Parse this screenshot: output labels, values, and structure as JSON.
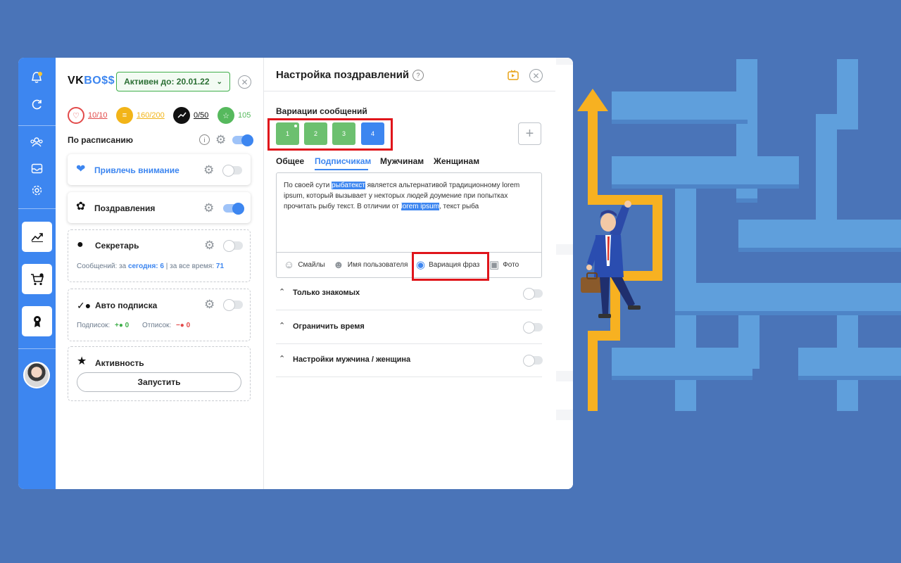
{
  "app": {
    "logo_vk": "VK",
    "logo_boss": "BO$$"
  },
  "left_panel": {
    "active_until": "Активен до: 20.01.22",
    "stats": [
      {
        "icon": "heart-icon",
        "value": "10/10",
        "color": "#e24a4a"
      },
      {
        "icon": "list-heart-icon",
        "value": "160/200",
        "color": "#f2b418"
      },
      {
        "icon": "trend-icon",
        "value": "0/50",
        "color": "#111111"
      },
      {
        "icon": "star-icon",
        "value": "105",
        "color": "#56b95d"
      }
    ],
    "schedule_label": "По расписанию",
    "cards": {
      "attention": {
        "title": "Привлечь внимание"
      },
      "congrats": {
        "title": "Поздравления"
      },
      "secretary": {
        "title": "Секретарь",
        "messages_label": "Сообщений: за",
        "today_label": "сегодня:",
        "today_value": "6",
        "sep": "|",
        "all_label": "за все время:",
        "all_value": "71"
      },
      "autosub": {
        "title": "Авто подписка",
        "sub_label": "Подписок:",
        "sub_value": "0",
        "unsub_label": "Отписок:",
        "unsub_value": "0"
      },
      "activity": {
        "title": "Активность",
        "run_label": "Запустить"
      }
    }
  },
  "right_panel": {
    "title": "Настройка поздравлений",
    "help": "?",
    "variations_label": "Вариации сообщений",
    "variations": [
      {
        "label": "1",
        "color": "#6cc06f"
      },
      {
        "label": "2",
        "color": "#6cc06f"
      },
      {
        "label": "3",
        "color": "#6cc06f"
      },
      {
        "label": "4",
        "color": "#3d86f0"
      }
    ],
    "add_label": "+",
    "tabs": [
      "Общее",
      "Подписчикам",
      "Мужчинам",
      "Женщинам"
    ],
    "editor": {
      "t1": "По своей сути ",
      "hl1": "рыбатекст",
      "t2": " является альтернативой традиционному lorem ipsum, который вызывает у некторых людей доумение при попытках прочитать рыбу текст. В отличии от ",
      "hl2": "lorem ipsum",
      "t3": ", текст рыба"
    },
    "tools": [
      "Смайлы",
      "Имя пользователя",
      "Вариация фраз",
      "Фото"
    ],
    "options": [
      "Только знакомых",
      "Ограничить время",
      "Настройки мужчина / женщина"
    ]
  },
  "colors": {
    "accent": "#3d86f0",
    "highlight_box": "#e0151b",
    "background": "#4a74b8"
  }
}
